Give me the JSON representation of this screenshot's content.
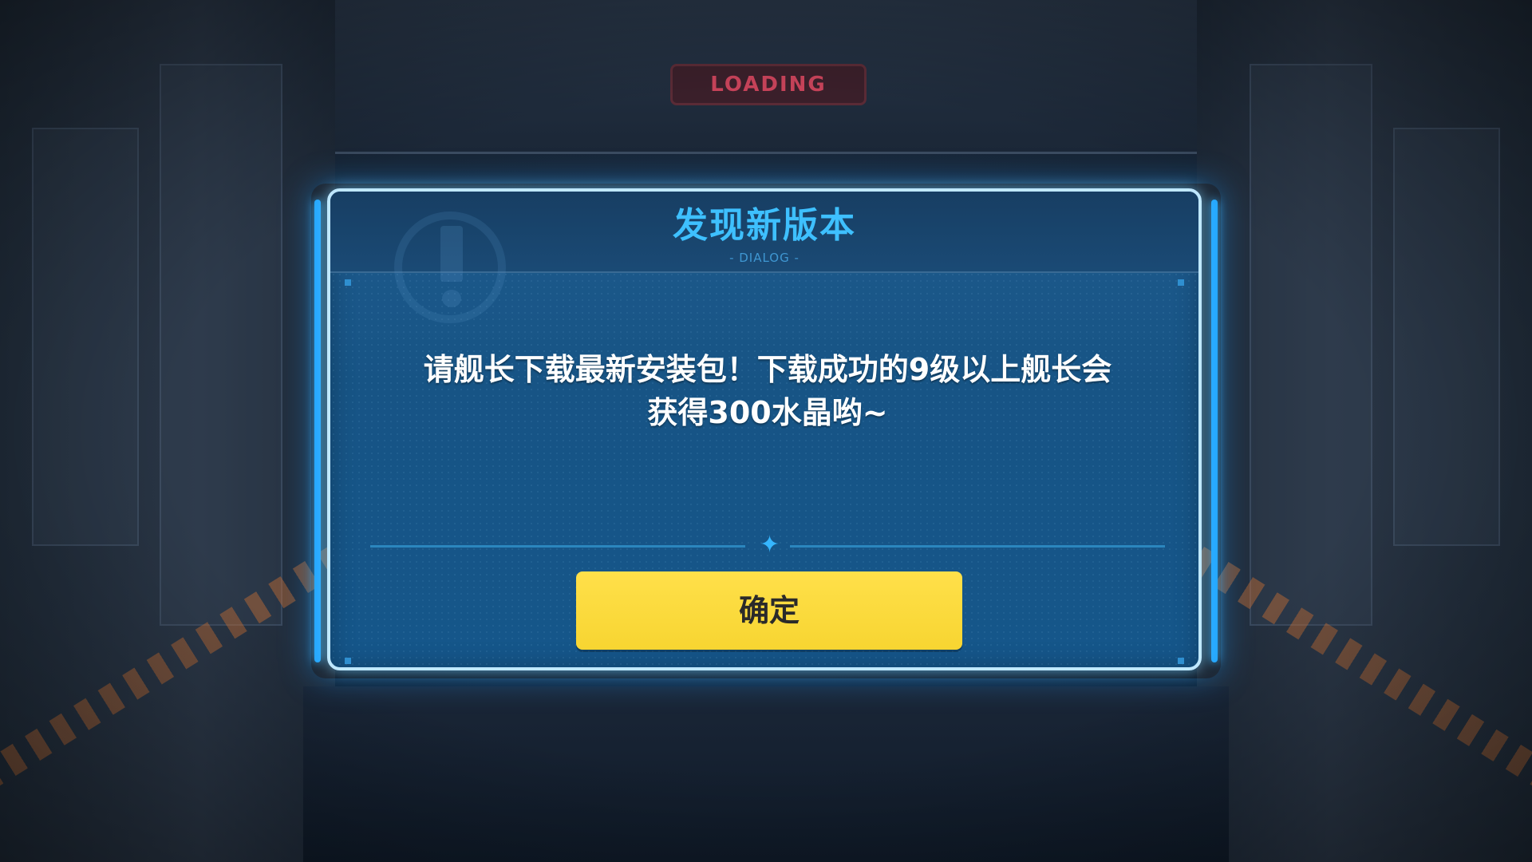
{
  "background": {
    "sign_text": "LOADING"
  },
  "dialog": {
    "title": "发现新版本",
    "subtitle": "- DIALOG -",
    "message_line1": "请舰长下载最新安装包！下载成功的9级以上舰长会",
    "message_line2": "获得300水晶哟~",
    "confirm_label": "确定"
  },
  "colors": {
    "title": "#3ec0ff",
    "button": "#f7d531",
    "dialog_bg": "#175485",
    "border_glow": "#26a9ff"
  },
  "icons": {
    "divider": "sparkle-icon",
    "watermark": "exclamation-icon"
  }
}
